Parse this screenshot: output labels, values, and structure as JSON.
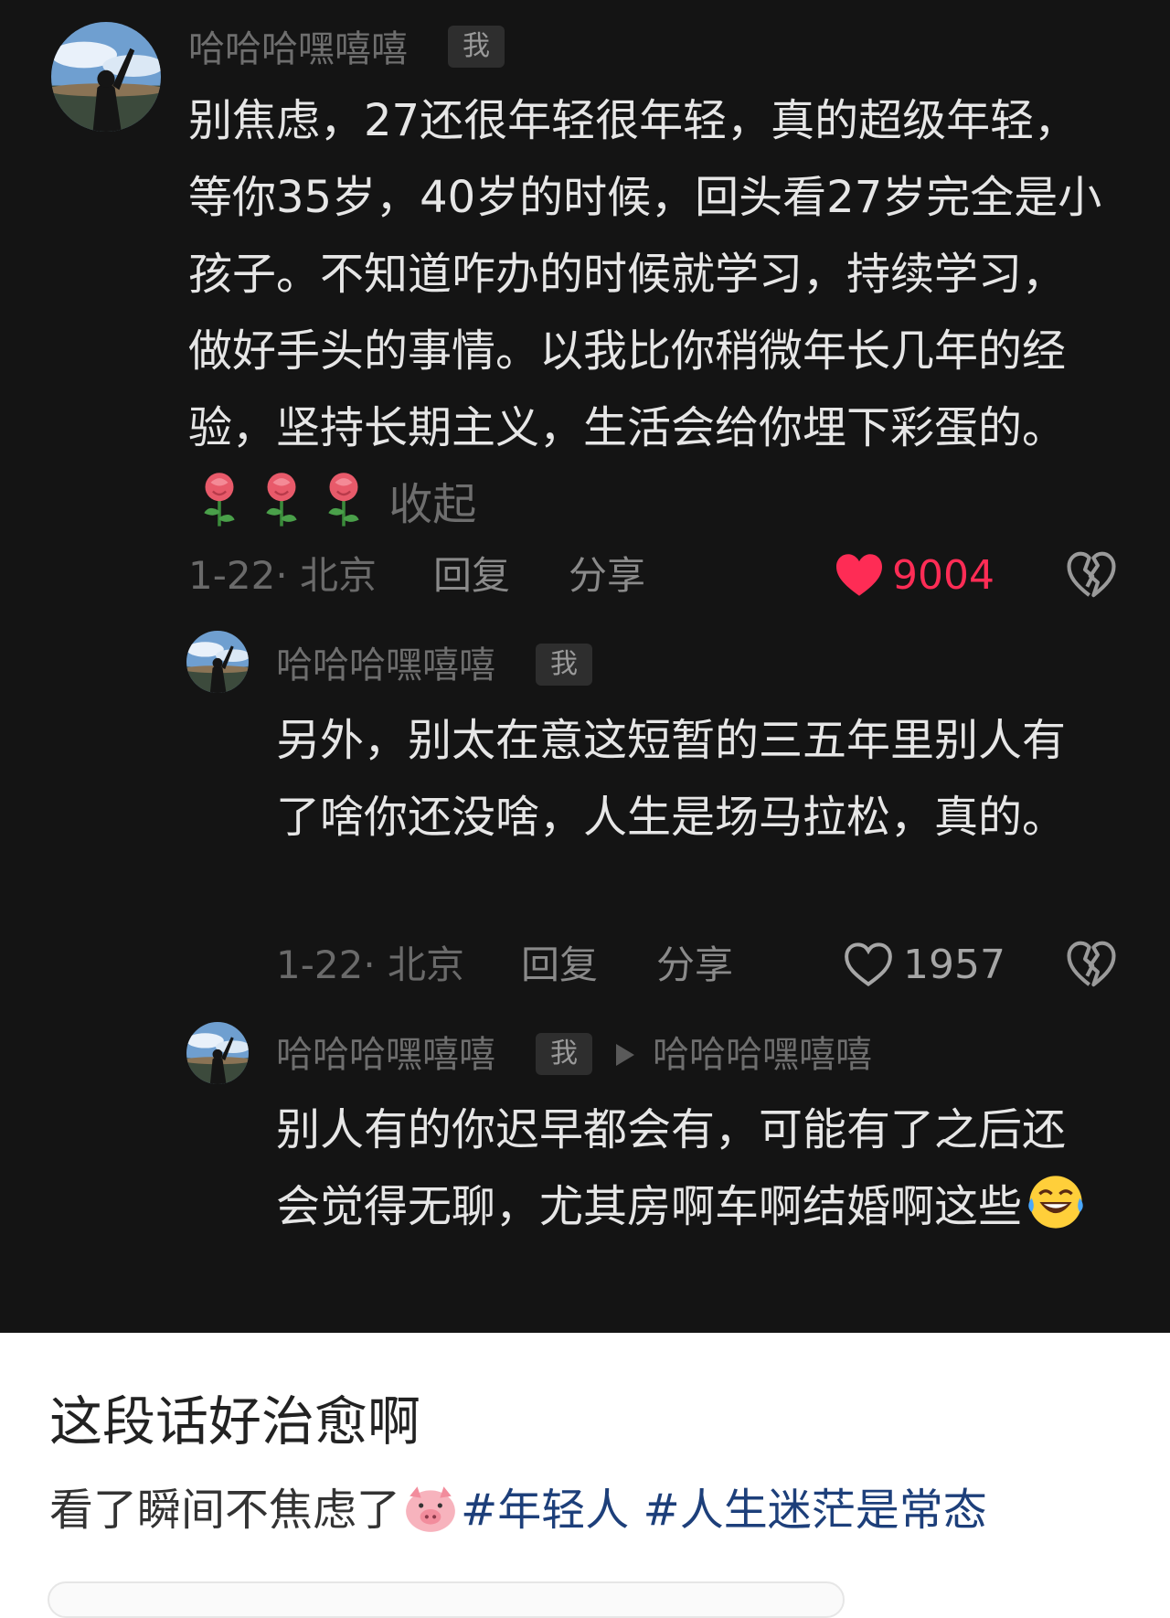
{
  "comments": [
    {
      "username": "哈哈哈嘿嘻嘻",
      "badge": "我",
      "text": "别焦虑，27还很年轻很年轻，真的超级年轻，等你35岁，40岁的时候，回头看27岁完全是小孩子。不知道咋办的时候就学习，持续学习，做好手头的事情。以我比你稍微年长几年的经验，坚持长期主义，生活会给你埋下彩蛋的。",
      "emojis": [
        "rose-emoji",
        "rose-emoji",
        "rose-emoji"
      ],
      "collapse_label": "收起",
      "date_location": "1-22· 北京",
      "reply_label": "回复",
      "share_label": "分享",
      "likes": "9004",
      "liked": true,
      "like_color": "#fe2c55"
    },
    {
      "username": "哈哈哈嘿嘻嘻",
      "badge": "我",
      "text": "另外，别太在意这短暂的三五年里别人有了啥你还没啥，人生是场马拉松，真的。",
      "date_location": "1-22· 北京",
      "reply_label": "回复",
      "share_label": "分享",
      "likes": "1957",
      "liked": false
    },
    {
      "username": "哈哈哈嘿嘻嘻",
      "badge": "我",
      "reply_to": "哈哈哈嘿嘻嘻",
      "text": "别人有的你迟早都会有，可能有了之后还会觉得无聊，尤其房啊车啊结婚啊这些",
      "emojis": [
        "laughing-tears-emoji"
      ]
    }
  ],
  "post": {
    "title": "这段话好治愈啊",
    "body": "看了瞬间不焦虑了",
    "emoji": "pig-emoji",
    "tags": [
      "#年轻人",
      "#人生迷茫是常态"
    ],
    "tag_color": "#1d3f7a"
  }
}
